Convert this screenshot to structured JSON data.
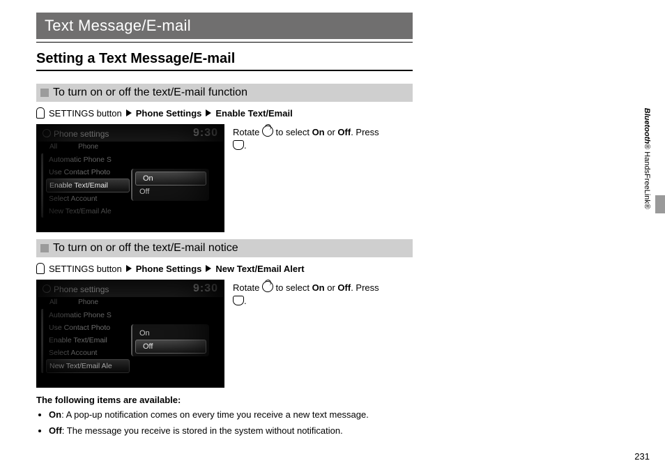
{
  "title": "Text Message/E-mail",
  "h2": "Setting a Text Message/E-mail",
  "section1": {
    "heading": "To turn on or off the text/E-mail function",
    "path_prefix": "SETTINGS button",
    "path_mid": "Phone Settings",
    "path_end": "Enable Text/Email",
    "desc_a": "Rotate ",
    "desc_b": " to select ",
    "on": "On",
    "or": " or ",
    "off": "Off",
    "desc_c": ". Press ",
    "desc_d": "."
  },
  "section2": {
    "heading": "To turn on or off the text/E-mail notice",
    "path_prefix": "SETTINGS button",
    "path_mid": "Phone Settings",
    "path_end": "New Text/Email Alert",
    "desc_a": "Rotate ",
    "desc_b": " to select ",
    "on": "On",
    "or": " or ",
    "off": "Off",
    "desc_c": ". Press ",
    "desc_d": "."
  },
  "avail": "The following items are available:",
  "bullets": {
    "on_label": "On",
    "on_text": ": A pop-up notification comes on every time you receive a new text message.",
    "off_label": "Off",
    "off_text": ": The message you receive is stored in the system without notification."
  },
  "device": {
    "title": "Phone settings",
    "clock": "9:30",
    "tab_all": "All",
    "tab_phone": "Phone",
    "opts": [
      "Automatic Phone S",
      "Use Contact Photo",
      "Enable Text/Email",
      "Select Account",
      "New Text/Email Ale"
    ],
    "popup": [
      "On",
      "Off"
    ]
  },
  "page_number": "231",
  "side_italic": "Bluetooth",
  "side_rest": "® HandsFreeLink®"
}
